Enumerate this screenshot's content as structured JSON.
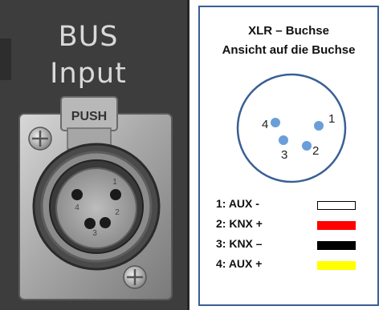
{
  "left_panel": {
    "title_line1": "BUS",
    "title_line2": "Input",
    "push_label": "PUSH",
    "connector_pin_numbers": [
      "4",
      "1",
      "3",
      "2"
    ]
  },
  "diagram": {
    "title_line1": "XLR – Buchse",
    "title_line2": "Ansicht auf die Buchse",
    "pins": [
      {
        "number": "4"
      },
      {
        "number": "1"
      },
      {
        "number": "3"
      },
      {
        "number": "2"
      }
    ],
    "legend": [
      {
        "label": "1: AUX -",
        "color": "#ffffff"
      },
      {
        "label": "2: KNX +",
        "color": "#ff0000"
      },
      {
        "label": "3: KNX –",
        "color": "#000000"
      },
      {
        "label": "4: AUX +",
        "color": "#ffff00"
      }
    ],
    "colors": {
      "border": "#3a5f94",
      "circle": "#3a5f94",
      "pin_dot": "#6a9ed8"
    }
  }
}
